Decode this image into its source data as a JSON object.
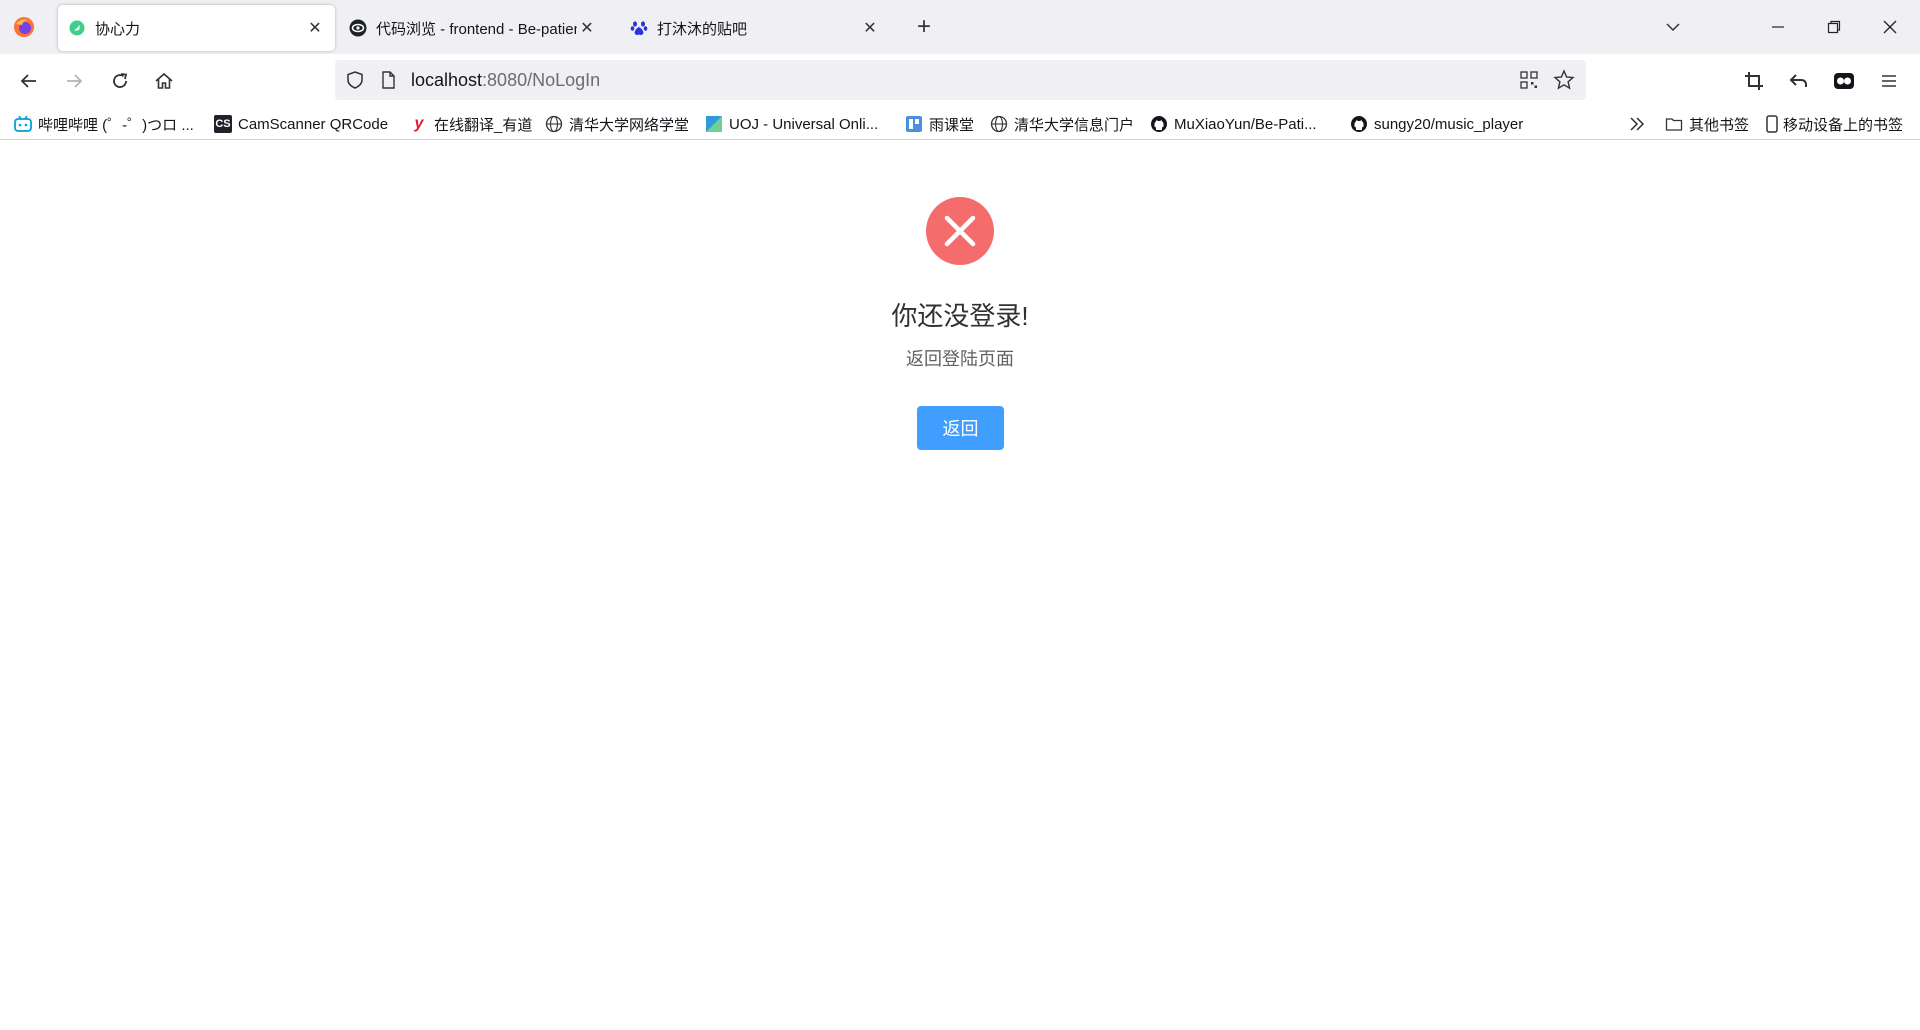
{
  "browser": {
    "tabs": [
      {
        "title": "协心力",
        "active": true
      },
      {
        "title": "代码浏览 - frontend - Be-patient",
        "active": false
      },
      {
        "title": "打沐沐的贴吧",
        "active": false
      }
    ],
    "url": {
      "host": "localhost",
      "rest": ":8080/NoLogIn"
    }
  },
  "bookmarks": {
    "items": [
      {
        "label": "哔哩哔哩 (゜-゜)つロ ...",
        "icon": "bilibili-icon"
      },
      {
        "label": "CamScanner QRCode",
        "icon": "camscanner-icon"
      },
      {
        "label": "在线翻译_有道",
        "icon": "youdao-icon"
      },
      {
        "label": "清华大学网络学堂",
        "icon": "globe-icon"
      },
      {
        "label": "UOJ - Universal Onli...",
        "icon": "uoj-icon"
      },
      {
        "label": "雨课堂",
        "icon": "yuketang-icon"
      },
      {
        "label": "清华大学信息门户",
        "icon": "globe-icon"
      },
      {
        "label": "MuXiaoYun/Be-Pati...",
        "icon": "github-icon"
      },
      {
        "label": "sungy20/music_player",
        "icon": "github-icon"
      }
    ],
    "other": "其他书签",
    "mobile": "移动设备上的书签"
  },
  "page": {
    "title": "你还没登录!",
    "subtitle": "返回登陆页面",
    "back_label": "返回"
  },
  "colors": {
    "error": "#f56c6c",
    "primary": "#409eff"
  }
}
